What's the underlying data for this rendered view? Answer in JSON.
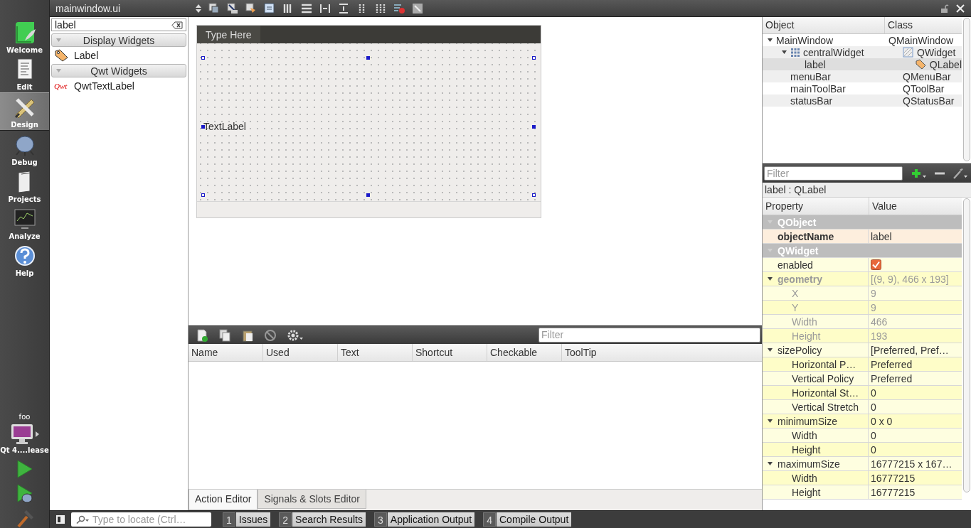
{
  "window": {
    "file": "mainwindow.ui"
  },
  "mode_bar": {
    "modes": [
      {
        "label": "Welcome",
        "kind": "welcome",
        "selected": false
      },
      {
        "label": "Edit",
        "kind": "edit",
        "selected": false
      },
      {
        "label": "Design",
        "kind": "design",
        "selected": true
      },
      {
        "label": "Debug",
        "kind": "debug",
        "selected": false
      },
      {
        "label": "Projects",
        "kind": "projects",
        "selected": false
      },
      {
        "label": "Analyze",
        "kind": "analyze",
        "selected": false
      },
      {
        "label": "Help",
        "kind": "help",
        "selected": false
      }
    ],
    "project": "foo",
    "kit": "Qt 4....lease"
  },
  "widget_box": {
    "search": "label",
    "categories": [
      {
        "title": "Display Widgets",
        "expanded": true,
        "items": [
          {
            "label": "Label",
            "kind": "label"
          }
        ]
      },
      {
        "title": "Qwt Widgets",
        "expanded": true,
        "items": [
          {
            "label": "QwtTextLabel",
            "kind": "qwt",
            "icon_text": "Qwt"
          }
        ]
      }
    ]
  },
  "form": {
    "menu_placeholder": "Type Here",
    "label_text": "TextLabel"
  },
  "action_editor": {
    "filter_placeholder": "Filter",
    "columns": [
      "Name",
      "Used",
      "Text",
      "Shortcut",
      "Checkable",
      "ToolTip"
    ],
    "tabs": [
      {
        "label": "Action Editor",
        "selected": true
      },
      {
        "label": "Signals & Slots Editor",
        "selected": false
      }
    ]
  },
  "object_inspector": {
    "columns": [
      "Object",
      "Class"
    ],
    "tree": [
      {
        "name": "MainWindow",
        "class": "QMainWindow",
        "selected": false,
        "expanded": true,
        "children": [
          {
            "name": "centralWidget",
            "class": "QWidget",
            "kind": "layout",
            "selected": false,
            "expanded": true,
            "children": [
              {
                "name": "label",
                "class": "QLabel",
                "kind": "label",
                "selected": true
              }
            ]
          },
          {
            "name": "menuBar",
            "class": "QMenuBar",
            "selected": false
          },
          {
            "name": "mainToolBar",
            "class": "QToolBar",
            "selected": false
          },
          {
            "name": "statusBar",
            "class": "QStatusBar",
            "selected": false
          }
        ]
      }
    ]
  },
  "property_editor": {
    "filter_placeholder": "Filter",
    "object": "label : QLabel",
    "columns": [
      "Property",
      "Value"
    ],
    "rows": [
      {
        "kind": "group",
        "name": "QObject",
        "expanded": true,
        "children": [
          {
            "kind": "text",
            "name": "objectName",
            "value": "label",
            "bold": true,
            "disabled": false
          }
        ]
      },
      {
        "kind": "group",
        "name": "QWidget",
        "expanded": true,
        "children": [
          {
            "kind": "checkbox",
            "name": "enabled",
            "checked": true,
            "bold": false,
            "disabled": false
          },
          {
            "kind": "text",
            "name": "geometry",
            "value": "[(9, 9), 466 x 193]",
            "bold": true,
            "disabled": true,
            "expanded": true,
            "children": [
              {
                "kind": "text",
                "name": "X",
                "value": "9",
                "bold": false,
                "disabled": true
              },
              {
                "kind": "text",
                "name": "Y",
                "value": "9",
                "bold": false,
                "disabled": true
              },
              {
                "kind": "text",
                "name": "Width",
                "value": "466",
                "bold": false,
                "disabled": true
              },
              {
                "kind": "text",
                "name": "Height",
                "value": "193",
                "bold": false,
                "disabled": true
              }
            ]
          },
          {
            "kind": "text",
            "name": "sizePolicy",
            "value": "[Preferred, Pref…",
            "bold": false,
            "disabled": false,
            "expanded": true,
            "children": [
              {
                "kind": "text",
                "name": "Horizontal P…",
                "value": "Preferred",
                "bold": false,
                "disabled": false
              },
              {
                "kind": "text",
                "name": "Vertical Policy",
                "value": "Preferred",
                "bold": false,
                "disabled": false
              },
              {
                "kind": "text",
                "name": "Horizontal St…",
                "value": "0",
                "bold": false,
                "disabled": false
              },
              {
                "kind": "text",
                "name": "Vertical Stretch",
                "value": "0",
                "bold": false,
                "disabled": false
              }
            ]
          },
          {
            "kind": "text",
            "name": "minimumSize",
            "value": "0 x 0",
            "bold": false,
            "disabled": false,
            "expanded": true,
            "children": [
              {
                "kind": "text",
                "name": "Width",
                "value": "0",
                "bold": false,
                "disabled": false
              },
              {
                "kind": "text",
                "name": "Height",
                "value": "0",
                "bold": false,
                "disabled": false
              }
            ]
          },
          {
            "kind": "text",
            "name": "maximumSize",
            "value": "16777215 x 167…",
            "bold": false,
            "disabled": false,
            "expanded": true,
            "children": [
              {
                "kind": "text",
                "name": "Width",
                "value": "16777215",
                "bold": false,
                "disabled": false
              },
              {
                "kind": "text",
                "name": "Height",
                "value": "16777215",
                "bold": false,
                "disabled": false
              }
            ]
          }
        ]
      }
    ]
  },
  "status_bar": {
    "locator_placeholder": "Type to locate (Ctrl…",
    "panes": [
      {
        "number": "1",
        "label": "Issues"
      },
      {
        "number": "2",
        "label": "Search Results"
      },
      {
        "number": "3",
        "label": "Application Output"
      },
      {
        "number": "4",
        "label": "Compile Output"
      }
    ]
  }
}
